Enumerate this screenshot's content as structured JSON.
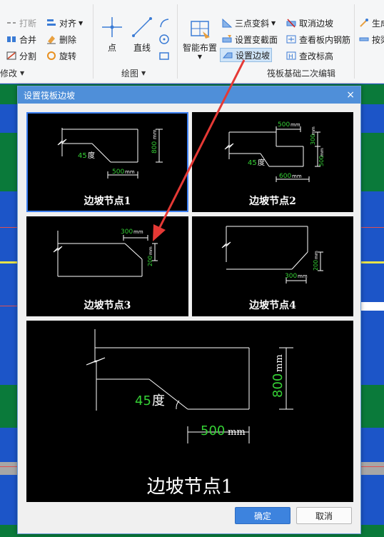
{
  "ribbon": {
    "modify": {
      "items": [
        "打断",
        "合并",
        "分割"
      ],
      "items2": [
        "对齐",
        "删除",
        "旋转"
      ],
      "group_label": "修改"
    },
    "draw": {
      "point": "点",
      "line": "直线",
      "group_label": "绘图"
    },
    "smart_layout": "智能布置",
    "slab_edit": {
      "col1": [
        "三点变斜",
        "设置变截面",
        "设置边坡"
      ],
      "col2": [
        "取消边坡",
        "查看板内钢筋",
        "查改标高"
      ],
      "group_label": "筏板基础二次编辑"
    },
    "right_cut": [
      "生成",
      "按梁"
    ]
  },
  "dialog": {
    "title": "设置筏板边坡",
    "close": "×",
    "ok": "确定",
    "cancel": "取消",
    "nodes": [
      {
        "label": "边坡节点1",
        "dims": {
          "angle": "45",
          "angle_unit": "度",
          "width": "500",
          "width_unit": "mm",
          "height": "800",
          "height_unit": "mm"
        }
      },
      {
        "label": "边坡节点2",
        "dims": {
          "angle": "45",
          "angle_unit": "度",
          "top": "500",
          "top_unit": "mm",
          "bottom": "600",
          "bottom_unit": "mm",
          "h1": "300",
          "h1_unit": "mm",
          "h2": "500",
          "h2_unit": "mm"
        }
      },
      {
        "label": "边坡节点3",
        "dims": {
          "width": "300",
          "width_unit": "mm",
          "height": "200",
          "height_unit": "mm"
        }
      },
      {
        "label": "边坡节点4",
        "dims": {
          "width": "300",
          "width_unit": "mm",
          "height": "200",
          "height_unit": "mm"
        }
      }
    ],
    "preview": {
      "label": "边坡节点1",
      "dims": {
        "angle": "45",
        "angle_unit": "度",
        "width": "500",
        "width_unit": "mm",
        "height": "800",
        "height_unit": "mm"
      }
    }
  },
  "colors": {
    "accent": "#3d83de",
    "dim_green": "#35d035",
    "annotation_red": "#e53935",
    "background_blue": "#1c55c8",
    "background_green": "#0a7a3a"
  }
}
